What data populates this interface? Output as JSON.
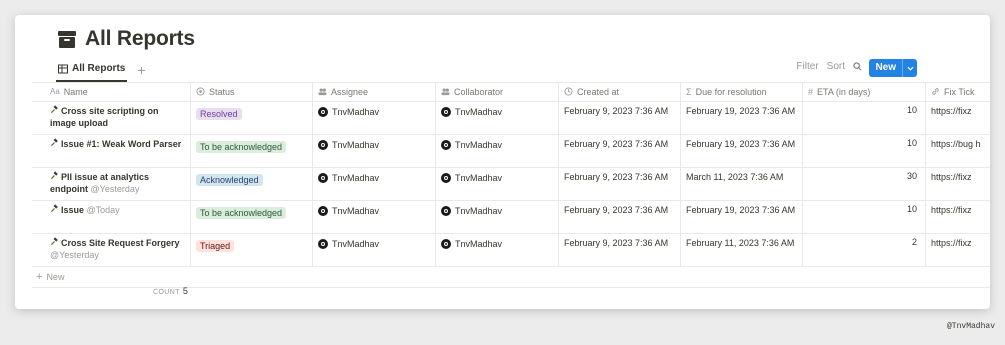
{
  "page": {
    "title": "All Reports"
  },
  "view_tabs": [
    {
      "label": "All Reports"
    }
  ],
  "toolbar": {
    "filter": "Filter",
    "sort": "Sort",
    "more": "···",
    "new_label": "New"
  },
  "columns": [
    {
      "key": "name",
      "label": "Name",
      "icon": "text-icon"
    },
    {
      "key": "status",
      "label": "Status",
      "icon": "status-icon"
    },
    {
      "key": "assignee",
      "label": "Assignee",
      "icon": "people-icon"
    },
    {
      "key": "collaborator",
      "label": "Collaborator",
      "icon": "people-icon"
    },
    {
      "key": "created",
      "label": "Created at",
      "icon": "clock-icon"
    },
    {
      "key": "due",
      "label": "Due for resolution",
      "icon": "sigma-icon"
    },
    {
      "key": "eta",
      "label": "ETA (in days)",
      "icon": "hash-icon"
    },
    {
      "key": "fix",
      "label": "Fix Tick",
      "icon": "link-icon"
    }
  ],
  "rows": [
    {
      "name": "Cross site scripting on image upload",
      "mention": "",
      "status": "Resolved",
      "status_bg": "#e8deee",
      "status_fg": "#6940a5",
      "assignee": "TnvMadhav",
      "collaborator": "TnvMadhav",
      "created": "February 9, 2023 7:36 AM",
      "due": "February 19, 2023 7:36 AM",
      "eta": "10",
      "fix": "https://fixz"
    },
    {
      "name": "Issue #1: Weak Word Parser",
      "mention": "",
      "status": "To be acknowledged",
      "status_bg": "#dbeddb",
      "status_fg": "#2b593f",
      "assignee": "TnvMadhav",
      "collaborator": "TnvMadhav",
      "created": "February 9, 2023 7:36 AM",
      "due": "February 19, 2023 7:36 AM",
      "eta": "10",
      "fix": "https://bug h"
    },
    {
      "name": "PII issue at analytics endpoint",
      "mention": "@Yesterday",
      "status": "Acknowledged",
      "status_bg": "#d3e5ef",
      "status_fg": "#28456c",
      "assignee": "TnvMadhav",
      "collaborator": "TnvMadhav",
      "created": "February 9, 2023 7:36 AM",
      "due": "March 11, 2023 7:36 AM",
      "eta": "30",
      "fix": "https://fixz"
    },
    {
      "name": "Issue",
      "mention": "@Today",
      "status": "To be acknowledged",
      "status_bg": "#dbeddb",
      "status_fg": "#2b593f",
      "assignee": "TnvMadhav",
      "collaborator": "TnvMadhav",
      "created": "February 9, 2023 7:36 AM",
      "due": "February 19, 2023 7:36 AM",
      "eta": "10",
      "fix": "https://fixz"
    },
    {
      "name": "Cross Site Request Forgery",
      "mention": "@Yesterday",
      "status": "Triaged",
      "status_bg": "#ffe2dd",
      "status_fg": "#5d1715",
      "assignee": "TnvMadhav",
      "collaborator": "TnvMadhav",
      "created": "February 9, 2023 7:36 AM",
      "due": "February 11, 2023 7:36 AM",
      "eta": "2",
      "fix": "https://fixz"
    }
  ],
  "footer": {
    "new_row": "New",
    "count_label": "COUNT",
    "count_value": "5"
  },
  "watermark": "@TnvMadhav",
  "colors": {
    "accent": "#2383e2",
    "text": "#37352f",
    "muted": "#9b9a97"
  }
}
